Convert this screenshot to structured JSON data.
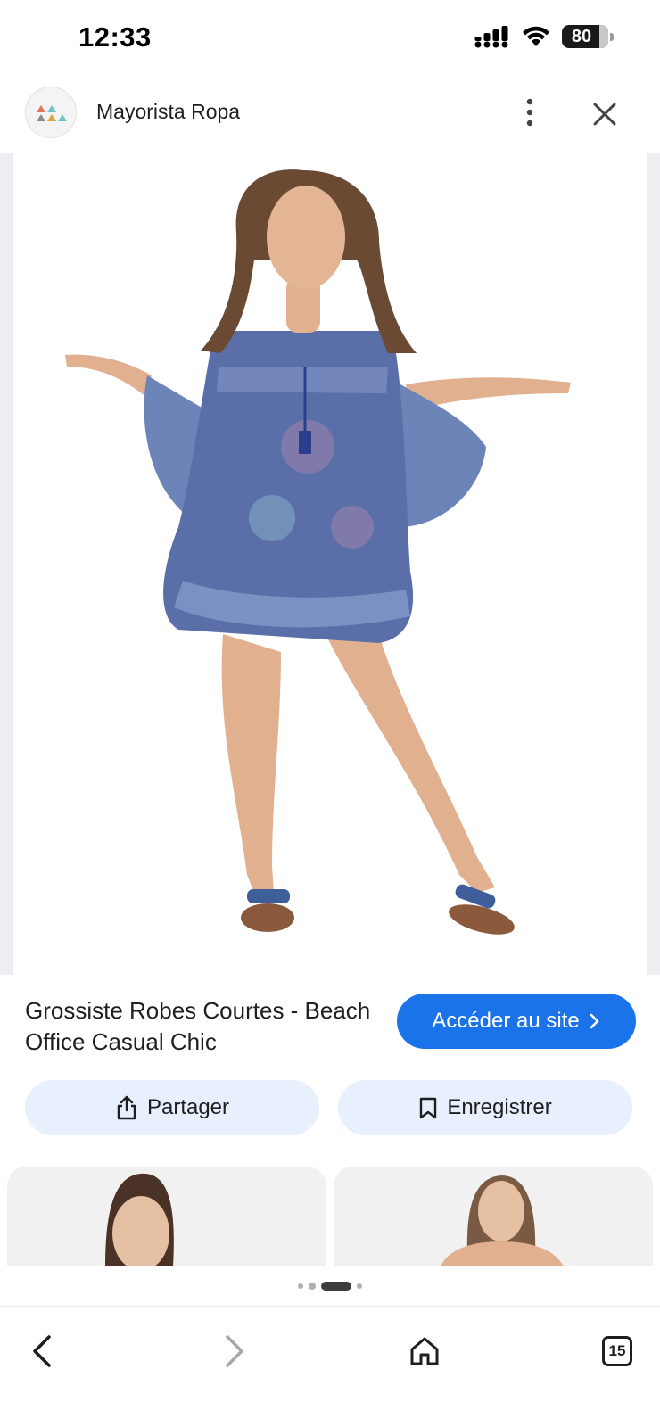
{
  "status_bar": {
    "time": "12:33",
    "battery": "80",
    "icons": [
      "signal-icon",
      "wifi-icon",
      "battery-icon"
    ]
  },
  "header": {
    "site_name": "Mayorista Ropa",
    "logo_icon": "site-logo-icon",
    "menu_icon": "more-vert-icon",
    "close_icon": "close-icon"
  },
  "result": {
    "title": "Grossiste Robes Courtes - Beach Office Casual Chic",
    "visit_label": "Accéder au site",
    "share_label": "Partager",
    "save_label": "Enregistrer"
  },
  "pager": {
    "count": 4,
    "active_index": 2
  },
  "bottom_nav": {
    "tabs_count": "15"
  },
  "colors": {
    "accent": "#1a73e8",
    "action_bg": "#e8f0fe",
    "dress_blue": "#5a6fa8"
  }
}
